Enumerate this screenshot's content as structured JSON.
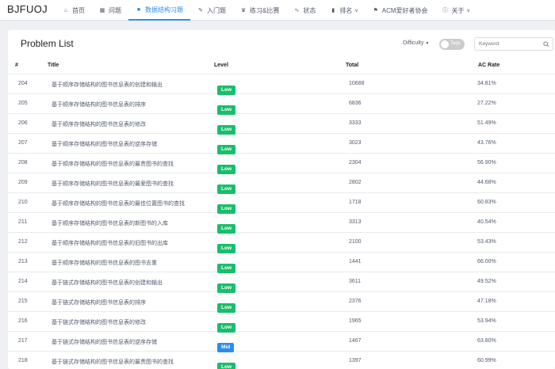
{
  "brand": "BJFUOJ",
  "nav": [
    {
      "label": "首页",
      "icon": "home-icon",
      "glyph": "⌂"
    },
    {
      "label": "问题",
      "icon": "grid-icon",
      "glyph": "▦"
    },
    {
      "label": "数据结构习题",
      "icon": "book-icon",
      "glyph": "■",
      "active": true
    },
    {
      "label": "入门题",
      "icon": "pencil-icon",
      "glyph": "✎"
    },
    {
      "label": "练习&比赛",
      "icon": "trophy-icon",
      "glyph": "♛"
    },
    {
      "label": "状态",
      "icon": "pulse-icon",
      "glyph": "∿"
    },
    {
      "label": "排名",
      "icon": "chart-icon",
      "glyph": "▮",
      "dropdown": true
    },
    {
      "label": "ACM爱好者协会",
      "icon": "flag-icon",
      "glyph": "⚑"
    },
    {
      "label": "关于",
      "icon": "info-icon",
      "glyph": "ⓘ",
      "dropdown": true
    }
  ],
  "card": {
    "title": "Problem List",
    "difficulty_label": "Difficulty",
    "tags_label": "Tags",
    "keyword_placeholder": "Keyword"
  },
  "columns": {
    "id": "#",
    "title": "Title",
    "level": "Level",
    "total": "Total",
    "ac_rate": "AC Rate"
  },
  "rows": [
    {
      "id": "204",
      "title": "基于顺序存储结构的图书信息表的创建和输出",
      "level": "Low",
      "total": "10688",
      "ac_rate": "34.81%"
    },
    {
      "id": "205",
      "title": "基于顺序存储结构的图书信息表的排序",
      "level": "Low",
      "total": "6836",
      "ac_rate": "27.22%"
    },
    {
      "id": "206",
      "title": "基于顺序存储结构的图书信息表的修改",
      "level": "Low",
      "total": "3333",
      "ac_rate": "51.49%"
    },
    {
      "id": "207",
      "title": "基于顺序存储结构的图书信息表的逆序存储",
      "level": "Low",
      "total": "3023",
      "ac_rate": "43.76%"
    },
    {
      "id": "208",
      "title": "基于顺序存储结构的图书信息表的最贵图书的查找",
      "level": "Low",
      "total": "2304",
      "ac_rate": "56.90%"
    },
    {
      "id": "209",
      "title": "基于顺序存储结构的图书信息表的最爱图书的查找",
      "level": "Low",
      "total": "2802",
      "ac_rate": "44.68%"
    },
    {
      "id": "210",
      "title": "基于顺序存储结构的图书信息表的最佳位置图书的查找",
      "level": "Low",
      "total": "1718",
      "ac_rate": "60.83%"
    },
    {
      "id": "211",
      "title": "基于顺序存储结构的图书信息表的新图书的入库",
      "level": "Low",
      "total": "3313",
      "ac_rate": "40.54%"
    },
    {
      "id": "212",
      "title": "基于顺序存储结构的图书信息表的旧图书的出库",
      "level": "Low",
      "total": "2100",
      "ac_rate": "53.43%"
    },
    {
      "id": "213",
      "title": "基于顺序存储结构的图书信息表的图书去重",
      "level": "Low",
      "total": "1441",
      "ac_rate": "66.00%"
    },
    {
      "id": "214",
      "title": "基于链式存储结构的图书信息表的创建和输出",
      "level": "Low",
      "total": "3611",
      "ac_rate": "49.52%"
    },
    {
      "id": "215",
      "title": "基于链式存储结构的图书信息表的排序",
      "level": "Low",
      "total": "2376",
      "ac_rate": "47.18%"
    },
    {
      "id": "216",
      "title": "基于链式存储结构的图书信息表的修改",
      "level": "Low",
      "total": "1965",
      "ac_rate": "53.94%"
    },
    {
      "id": "217",
      "title": "基于链式存储结构的图书信息表的逆序存储",
      "level": "Mid",
      "total": "1467",
      "ac_rate": "63.80%"
    },
    {
      "id": "218",
      "title": "基于链式存储结构的图书信息表的最贵图书的查找",
      "level": "Low",
      "total": "1397",
      "ac_rate": "60.99%"
    }
  ],
  "colors": {
    "accent": "#2d8cf0",
    "low": "#19be6b",
    "mid": "#2d8cf0"
  }
}
